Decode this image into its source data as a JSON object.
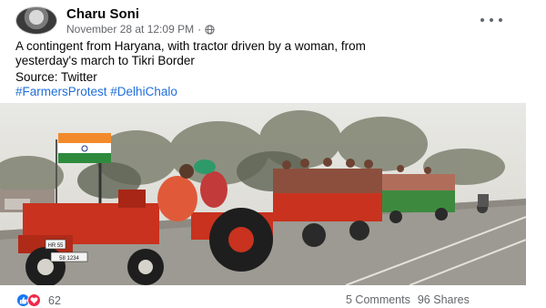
{
  "post": {
    "author": "Charu Soni",
    "timestamp": "November 28 at 12:09 PM",
    "separator": "·",
    "text_line1": "A contingent from Haryana, with tractor driven by a woman, from",
    "text_line2": "yesterday's march to Tikri Border",
    "source": "Source: Twitter",
    "hashtags": [
      "#FarmersProtest",
      "#DelhiChalo"
    ]
  },
  "footer": {
    "reaction_count": "62",
    "comments": "5 Comments",
    "shares": "96 Shares"
  },
  "photo": {
    "plates": [
      "HR 55",
      "58 1234"
    ]
  },
  "icons": {
    "privacy": "globe-icon",
    "menu": "more-horizontal-icon",
    "reaction1": "like-icon",
    "reaction2": "love-icon"
  },
  "colors": {
    "link": "#216fdb",
    "like": "#1877f2",
    "love": "#f02849",
    "secondary_text": "#65676b",
    "tractor_red": "#c8321e"
  }
}
